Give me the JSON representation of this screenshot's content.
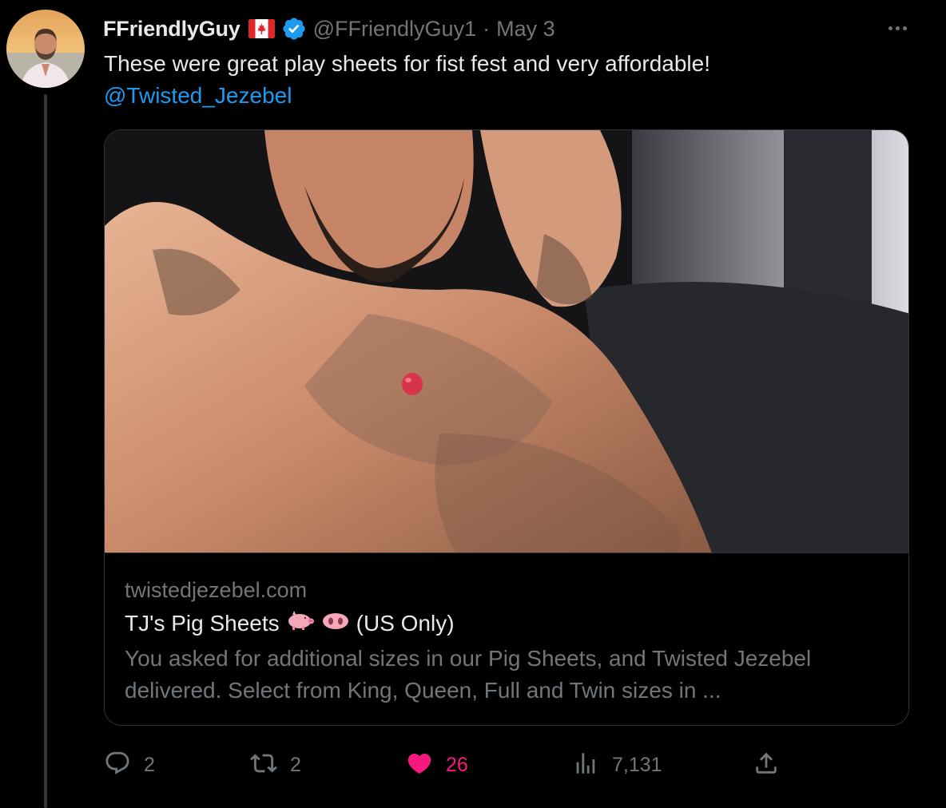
{
  "tweet": {
    "display_name": "FFriendlyGuy",
    "handle": "@FFriendlyGuy1",
    "separator": "·",
    "date": "May 3",
    "flag_icon": "canada-flag-icon",
    "verified_icon": "verified-badge-icon",
    "text": "These were great play sheets for fist fest and very affordable!",
    "mention": "@Twisted_Jezebel",
    "colors": {
      "accent": "#1d9bf0",
      "like": "#f91880",
      "muted": "#71767b",
      "text": "#e7e9ea",
      "background": "#000000"
    }
  },
  "card": {
    "domain": "twistedjezebel.com",
    "title": "TJ's Pig Sheets",
    "title_suffix": "(US Only)",
    "emojis": [
      "pig-icon",
      "pig-nose-icon"
    ],
    "description": "You asked for additional sizes in our Pig Sheets, and Twisted Jezebel delivered. Select from King, Queen, Full and Twin sizes in ..."
  },
  "actions": {
    "reply": {
      "icon": "reply-icon",
      "count": "2"
    },
    "retweet": {
      "icon": "retweet-icon",
      "count": "2"
    },
    "like": {
      "icon": "heart-icon",
      "count": "26",
      "liked": true
    },
    "views": {
      "icon": "views-icon",
      "count": "7,131"
    },
    "share": {
      "icon": "share-icon"
    }
  }
}
